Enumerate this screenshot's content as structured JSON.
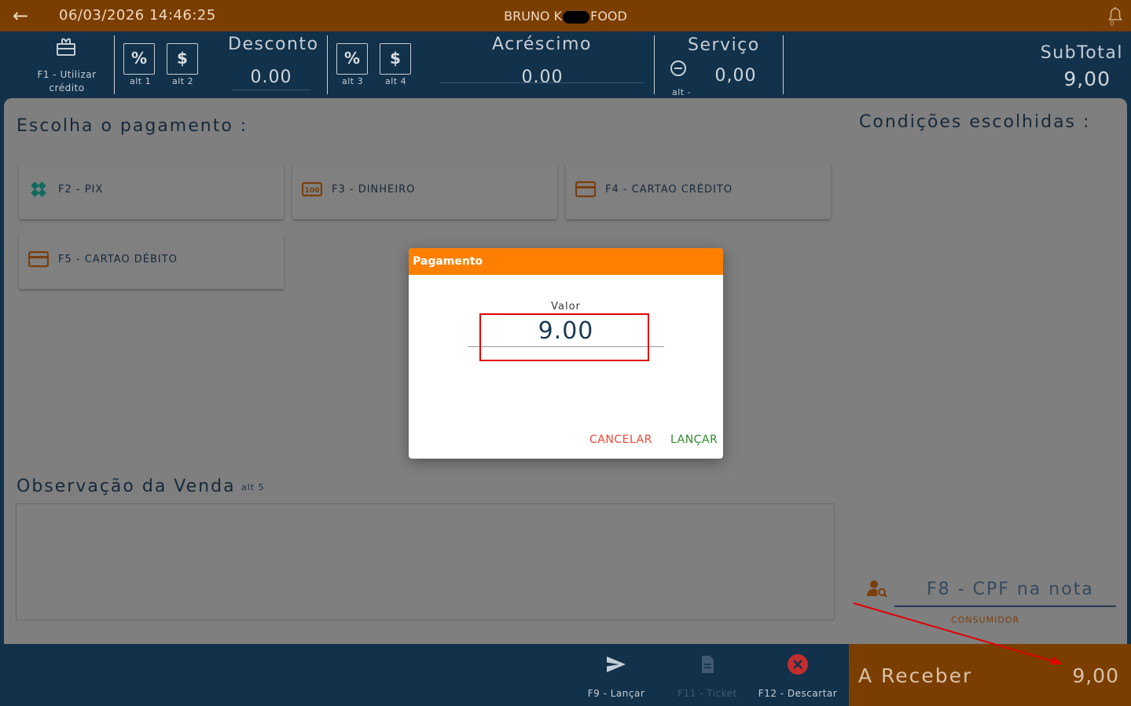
{
  "topbar": {
    "datetime": "06/03/2026 14:46:25",
    "store_prefix": "BRUNO K",
    "store_suffix": "FOOD",
    "notification_count": "0"
  },
  "header": {
    "credit_label": "F1 -  Utilizar crédito",
    "desconto": {
      "title": "Desconto",
      "value": "0.00",
      "pct_alt": "alt 1",
      "money_alt": "alt 2"
    },
    "acrescimo": {
      "title": "Acréscimo",
      "value": "0.00",
      "pct_alt": "alt 3",
      "money_alt": "alt 4"
    },
    "servico": {
      "title": "Serviço",
      "value": "0,00",
      "alt": "alt -"
    },
    "subtotal": {
      "title": "SubTotal",
      "value": "9,00"
    },
    "pct_symbol": "%",
    "money_symbol": "$"
  },
  "main": {
    "payment_title": "Escolha o pagamento :",
    "conditions_title": "Condições escolhidas :",
    "payment_methods": [
      {
        "label": "F2 - PIX",
        "icon": "pix-icon",
        "color": "#0f6b5f"
      },
      {
        "label": "F3 - DINHEIRO",
        "icon": "cash-icon",
        "color": "#7a3e0b"
      },
      {
        "label": "F4 - CARTAO CRÉDITO",
        "icon": "credit-card-icon",
        "color": "#7a3e0b"
      },
      {
        "label": "F5 - CARTAO DÉBITO",
        "icon": "debit-card-icon",
        "color": "#7a3e0b"
      }
    ],
    "obs_title": "Observação da Venda",
    "obs_alt": "alt 5",
    "obs_value": "",
    "cpf_placeholder": "F8 - CPF na nota",
    "cpf_sub": "CONSUMIDOR"
  },
  "bottom": {
    "lancar": "F9 - Lançar",
    "ticket": "F11 - Ticket",
    "descartar": "F12 - Descartar",
    "receber_label": "A Receber",
    "receber_value": "9,00"
  },
  "dialog": {
    "title": "Pagamento",
    "field_label": "Valor",
    "value": "9.00",
    "cancel": "CANCELAR",
    "confirm": "LANÇAR"
  },
  "colors": {
    "accent": "#ff8000",
    "topbar": "#7a3e00",
    "navy": "#12314a",
    "cancel": "#f44336",
    "confirm": "#2e8b2e",
    "annotation": "#e00000"
  }
}
